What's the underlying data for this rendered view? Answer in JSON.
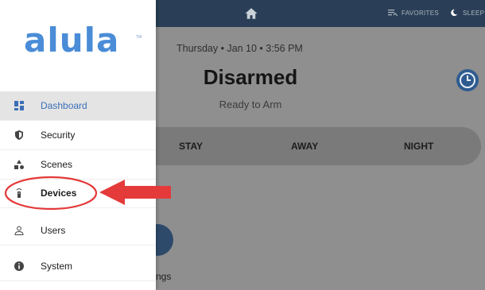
{
  "topbar": {
    "favorites_label": "FAVORITES",
    "sleep_label": "SLEEP"
  },
  "status": {
    "datetime": "Thursday  •  Jan 10  •  3:56 PM",
    "title": "Disarmed",
    "subtitle": "Ready to Arm"
  },
  "arm_options": [
    "STAY",
    "AWAY",
    "NIGHT"
  ],
  "settings_label": "ngs",
  "brand": {
    "logo_text": "alula",
    "trademark": "TM",
    "accent_color": "#4a8cd7"
  },
  "sidebar": {
    "items": [
      {
        "label": "Dashboard",
        "icon": "dashboard-icon",
        "active": true
      },
      {
        "label": "Security",
        "icon": "shield-icon"
      },
      {
        "label": "Scenes",
        "icon": "scenes-icon"
      },
      {
        "label": "Devices",
        "icon": "remote-icon"
      },
      {
        "label": "Users",
        "icon": "user-icon"
      },
      {
        "label": "System",
        "icon": "info-icon"
      }
    ]
  },
  "annotation": {
    "color": "#e53a3a"
  }
}
